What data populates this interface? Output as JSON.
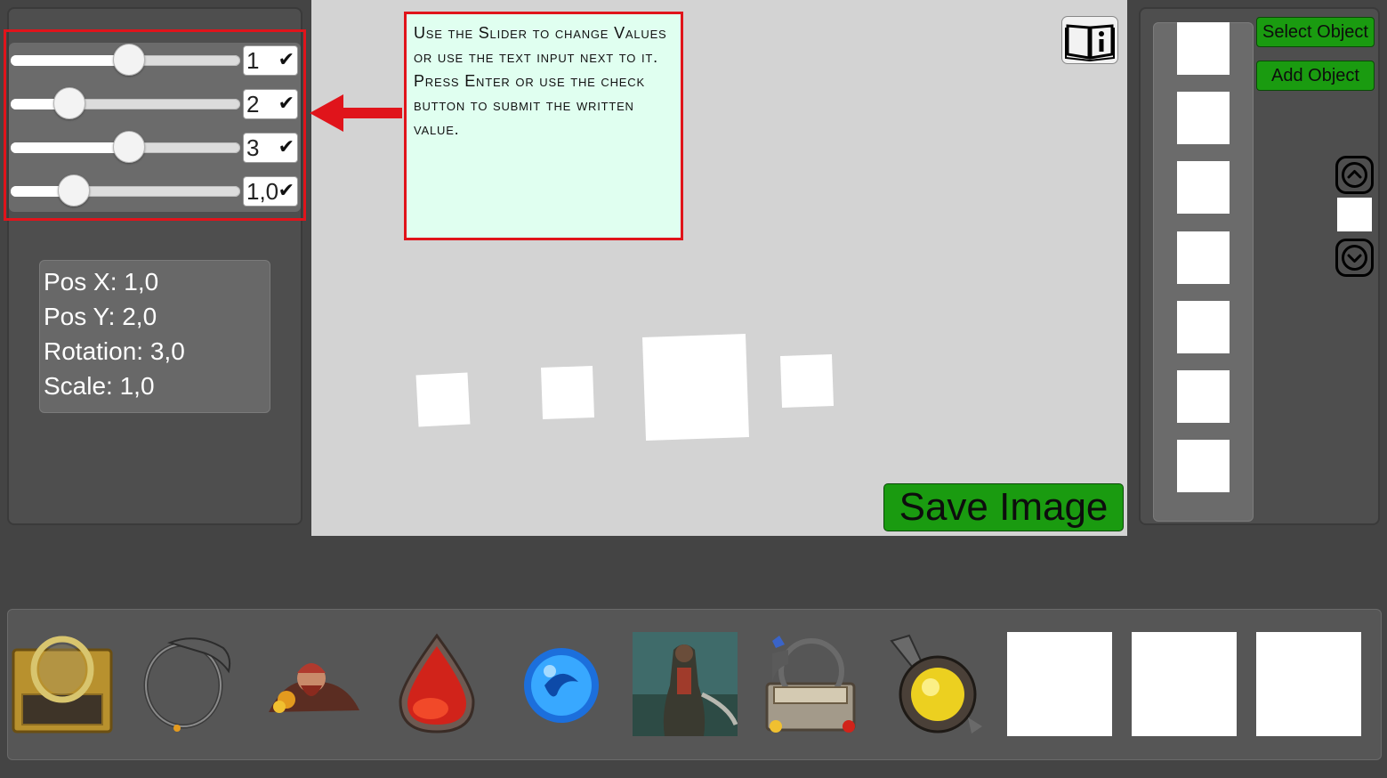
{
  "sliders": [
    {
      "value_text": "1",
      "fraction": 0.51,
      "check_icon": "checkmark-icon"
    },
    {
      "value_text": "2",
      "fraction": 0.25,
      "check_icon": "checkmark-icon"
    },
    {
      "value_text": "3",
      "fraction": 0.51,
      "check_icon": "checkmark-icon"
    },
    {
      "value_text": "1,0",
      "fraction": 0.27,
      "check_icon": "checkmark-icon"
    }
  ],
  "info": {
    "pos_x": "Pos X: 1,0",
    "pos_y": "Pos Y: 2,0",
    "rotation": "Rotation: 3,0",
    "scale": "Scale: 1,0"
  },
  "tooltip": {
    "text": "Use the Slider to change Values or use the text input next to it. Press Enter or use the check button to submit the written value."
  },
  "canvas": {
    "info_icon": "book-info-icon",
    "save_label": "Save Image"
  },
  "right_panel": {
    "select_label": "Select Object",
    "add_label": "Add Object",
    "up_icon": "chevron-up-icon",
    "down_icon": "chevron-down-icon"
  },
  "bottom_assets": [
    {
      "name": "golden-portrait-frame"
    },
    {
      "name": "dragon-ring-frame"
    },
    {
      "name": "dwarf-character"
    },
    {
      "name": "red-drop-gem"
    },
    {
      "name": "blue-orb"
    },
    {
      "name": "warrior-portrait"
    },
    {
      "name": "ornate-card-frame"
    },
    {
      "name": "yellow-potion"
    },
    {
      "name": "blank-slot"
    },
    {
      "name": "blank-slot"
    },
    {
      "name": "blank-slot"
    }
  ],
  "colors": {
    "accent_green": "#1a9b10",
    "highlight_red": "#e0141b",
    "tooltip_bg": "#e0fff0"
  }
}
